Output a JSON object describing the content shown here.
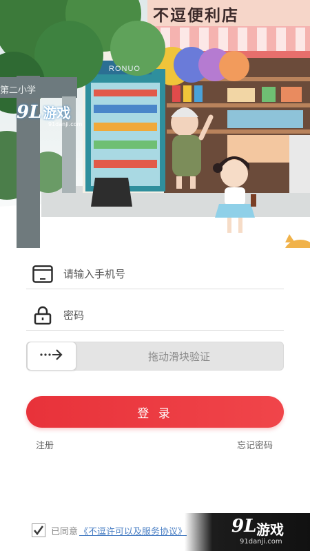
{
  "hero": {
    "shop_sign": "不逗便利店",
    "brand_sign": "RONUO",
    "school_sign": "第二小学",
    "watermark": {
      "number": "9L",
      "text": "游戏",
      "url": "91danji.com"
    }
  },
  "form": {
    "phone_placeholder": "请输入手机号",
    "password_placeholder": "密码",
    "slider_label": "拖动滑块验证",
    "login_label": "登 录",
    "register_label": "注册",
    "forgot_label": "忘记密码"
  },
  "agreement": {
    "checked": true,
    "prefix": "已同意",
    "link_text": "《不逗许可以及服务协议》"
  },
  "watermark_bottom": {
    "number": "9L",
    "text": "游戏",
    "url": "91danji.com"
  },
  "colors": {
    "accent": "#e8323a",
    "link": "#4a7fc4",
    "shop_teal": "#2f8f9d",
    "awning": "#f08a8a"
  },
  "icons": [
    "tablet-icon",
    "lock-icon",
    "arrow-right-icon",
    "checkmark-icon"
  ]
}
